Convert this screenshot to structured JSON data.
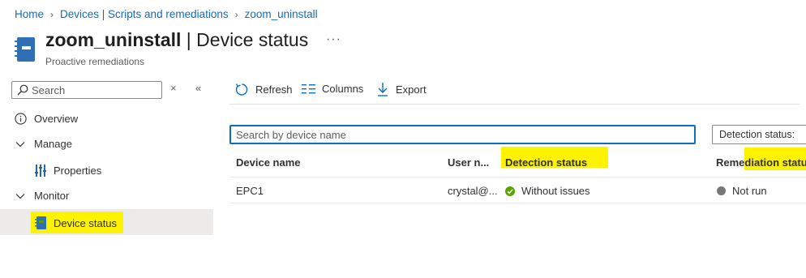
{
  "breadcrumb": {
    "items": [
      "Home",
      "Devices | Scripts and remediations",
      "zoom_uninstall"
    ]
  },
  "header": {
    "title_name": "zoom_uninstall",
    "title_sep": " | ",
    "title_page": "Device status",
    "more": "···",
    "subtitle": "Proactive remediations"
  },
  "nav": {
    "search_placeholder": "Search",
    "close_glyph": "×",
    "collapse_glyph": "«",
    "items": [
      {
        "label": "Overview",
        "icon": "info-icon"
      },
      {
        "label": "Manage",
        "icon": "chevron-down-icon"
      },
      {
        "label": "Properties",
        "icon": "properties-icon"
      },
      {
        "label": "Monitor",
        "icon": "chevron-down-icon"
      },
      {
        "label": "Device status",
        "icon": "device-status-icon",
        "selected": true
      }
    ]
  },
  "toolbar": {
    "refresh": "Refresh",
    "columns": "Columns",
    "export": "Export"
  },
  "filters": {
    "search_placeholder": "Search by device name",
    "detection_filter": "Detection status:"
  },
  "table": {
    "columns": [
      "Device name",
      "User n...",
      "Detection status",
      "Remediation statu"
    ],
    "rows": [
      {
        "device": "EPC1",
        "user": "crystal@...",
        "detection": "Without issues",
        "remediation": "Not run"
      }
    ]
  },
  "colors": {
    "accent": "#0f6cbd",
    "highlight": "#fdf200",
    "success": "#57a300",
    "neutral": "#797775"
  }
}
